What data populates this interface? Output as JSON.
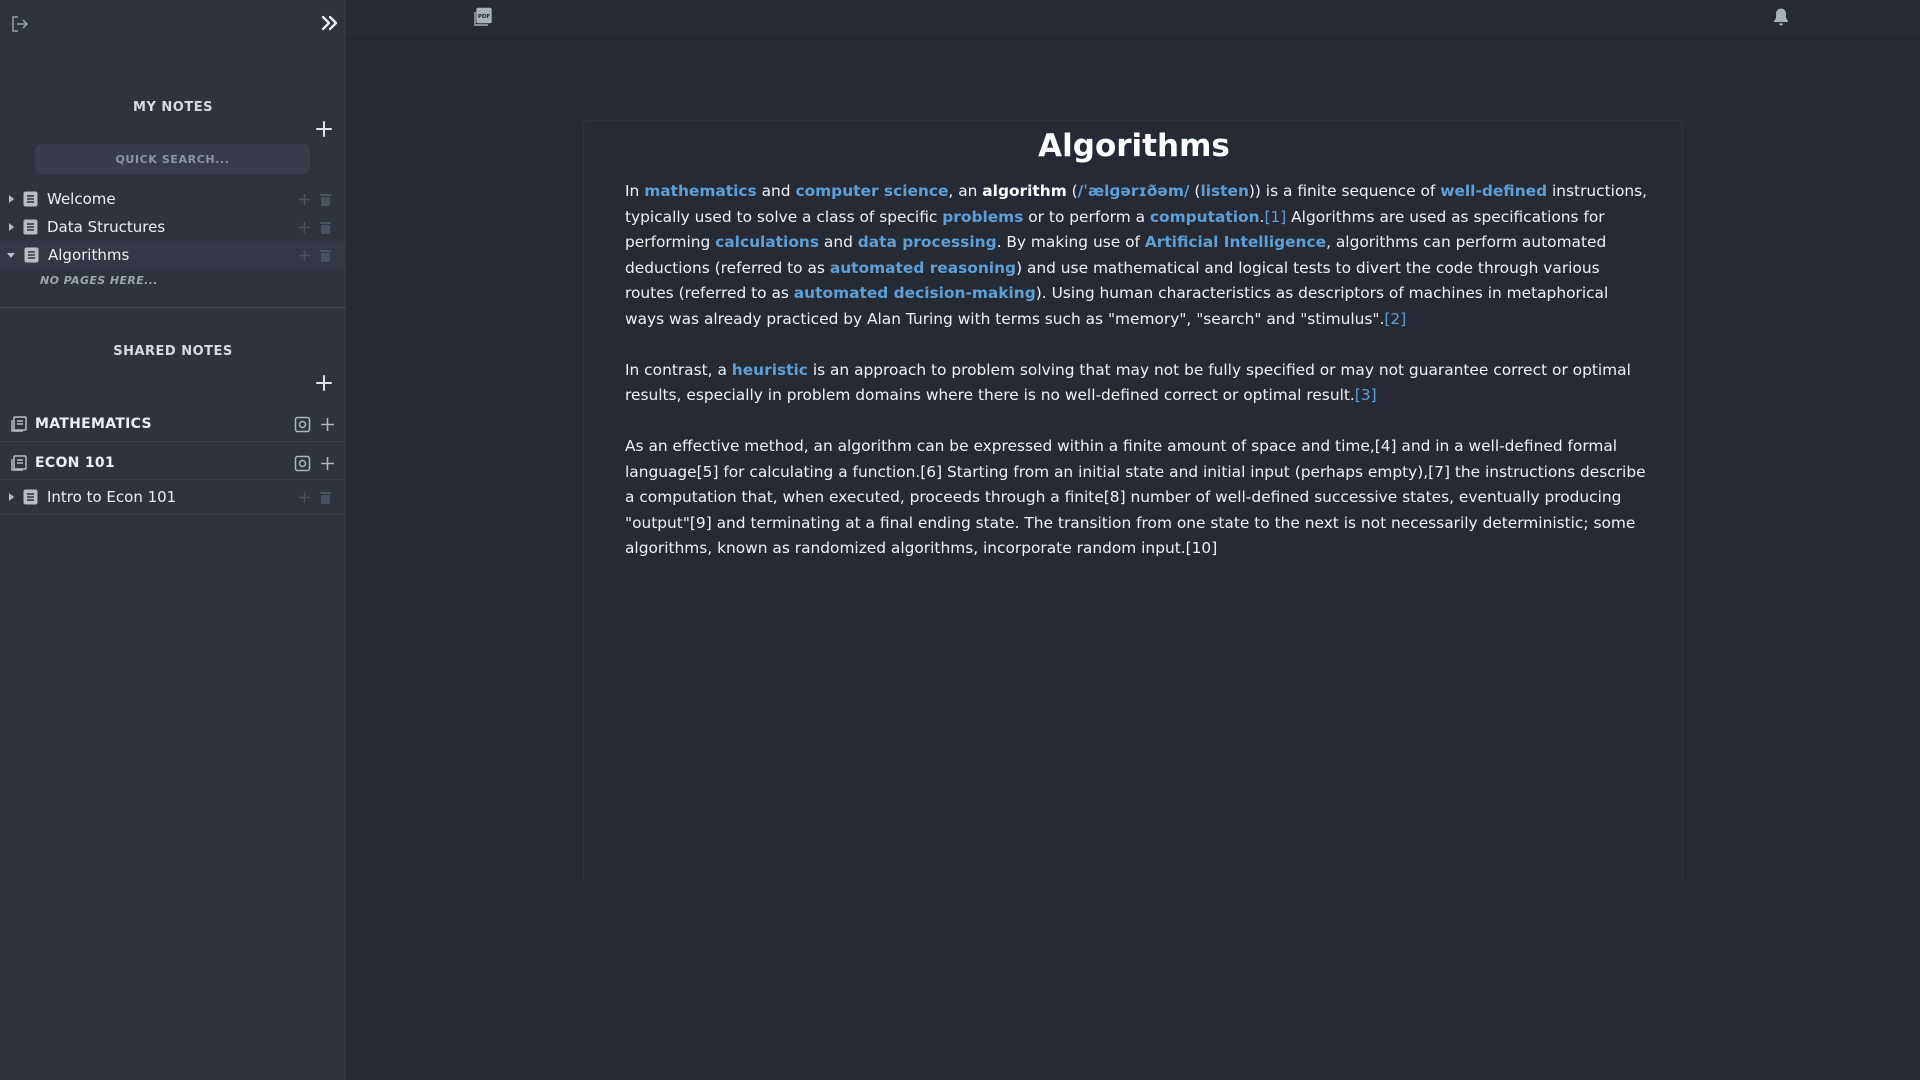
{
  "sidebar": {
    "my_notes_title": "MY NOTES",
    "search_placeholder": "QUICK SEARCH...",
    "my_notes": [
      {
        "label": "Welcome"
      },
      {
        "label": "Data Structures"
      },
      {
        "label": "Algorithms"
      }
    ],
    "no_pages": "NO PAGES HERE...",
    "shared_notes_title": "SHARED NOTES",
    "shared_groups": [
      {
        "label": "MATHEMATICS"
      },
      {
        "label": "ECON 101"
      }
    ],
    "shared_pages": [
      {
        "label": "Intro to Econ 101"
      }
    ]
  },
  "document": {
    "title": "Algorithms",
    "p1": {
      "t1": "In ",
      "l_math": "mathematics",
      "t2": " and ",
      "l_cs": "computer science",
      "t3": ", an ",
      "b_algo": "algorithm",
      "t4": " (",
      "l_ipa": "/ˈælɡərɪðəm/",
      "t5": " (",
      "l_listen": "listen",
      "t6": ")) is a finite sequence of ",
      "l_welldef": "well-defined",
      "t7": " instructions, typically used to solve a class of specific ",
      "l_problems": "problems",
      "t8": " or to perform a ",
      "l_computation": "computation",
      "t9": ".",
      "l_ref1": "[1]",
      "t10": " Algorithms are used as specifications for performing ",
      "l_calc": "calculations",
      "t11": " and ",
      "l_dataproc": "data processing",
      "t12": ". By making use of ",
      "l_ai": "Artificial Intelligence",
      "t13": ", algorithms can perform automated deductions (referred to as ",
      "l_autoreason": "automated reasoning",
      "t14": ") and use mathematical and logical tests to divert the code through various routes (referred to as ",
      "l_autodec": "automated decision-making",
      "t15": "). Using human characteristics as descriptors of machines in metaphorical ways was already practiced by Alan Turing with terms such as \"memory\", \"search\" and \"stimulus\".",
      "l_ref2": "[2]"
    },
    "p2": {
      "t1": "In contrast, a ",
      "l_heuristic": "heuristic",
      "t2": " is an approach to problem solving that may not be fully specified or may not guarantee correct or optimal results, especially in problem domains where there is no well-defined correct or optimal result.",
      "l_ref3": "[3]"
    },
    "p3": "As an effective method, an algorithm can be expressed within a finite amount of space and time,[4] and in a well-defined formal language[5] for calculating a function.[6] Starting from an initial state and initial input (perhaps empty),[7] the instructions describe a computation that, when executed, proceeds through a finite[8] number of well-defined successive states, eventually producing \"output\"[9] and terminating at a final ending state. The transition from one state to the next is not necessarily deterministic; some algorithms, known as randomized algorithms, incorporate random input.[10]"
  },
  "colors": {
    "link": "#5e9fd6",
    "sidebar_bg": "#2f3340",
    "main_bg": "#262a35"
  }
}
